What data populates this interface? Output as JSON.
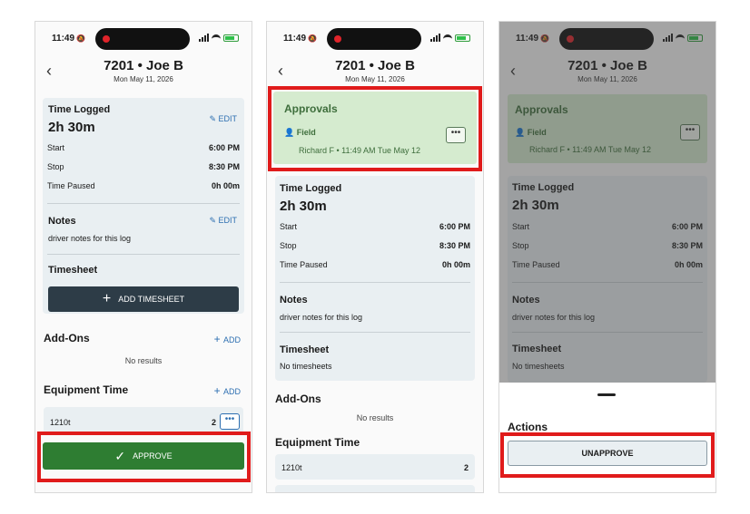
{
  "status": {
    "time": "11:49",
    "bell": "🔕"
  },
  "header": {
    "title": "7201 • Joe B",
    "date": "Mon May 11, 2026",
    "back_icon": "chevron-left-icon"
  },
  "time_logged": {
    "title": "Time Logged",
    "duration": "2h 30m",
    "edit_label": "EDIT",
    "start_label": "Start",
    "start_value": "6:00 PM",
    "stop_label": "Stop",
    "stop_value": "8:30 PM",
    "paused_label": "Time Paused",
    "paused_value": "0h 00m"
  },
  "notes": {
    "title": "Notes",
    "edit_label": "EDIT",
    "text": "driver notes for this log"
  },
  "timesheet": {
    "title": "Timesheet",
    "add_label": "ADD TIMESHEET",
    "empty": "No timesheets"
  },
  "addons": {
    "title": "Add-Ons",
    "add_label": "ADD",
    "empty": "No results"
  },
  "equipment": {
    "title": "Equipment Time",
    "add_label": "ADD",
    "item_name": "1210t",
    "item_count": "2"
  },
  "approve_button": "APPROVE",
  "approvals": {
    "title": "Approvals",
    "field_label": "Field",
    "meta": "Richard F • 11:49 AM Tue May 12"
  },
  "actions": {
    "title": "Actions",
    "unapprove_label": "UNAPPROVE"
  },
  "colors": {
    "highlight": "#e01b1b",
    "approve": "#2e7d32",
    "approvals_bg": "#d5ebcf",
    "link": "#2d6fb1"
  }
}
